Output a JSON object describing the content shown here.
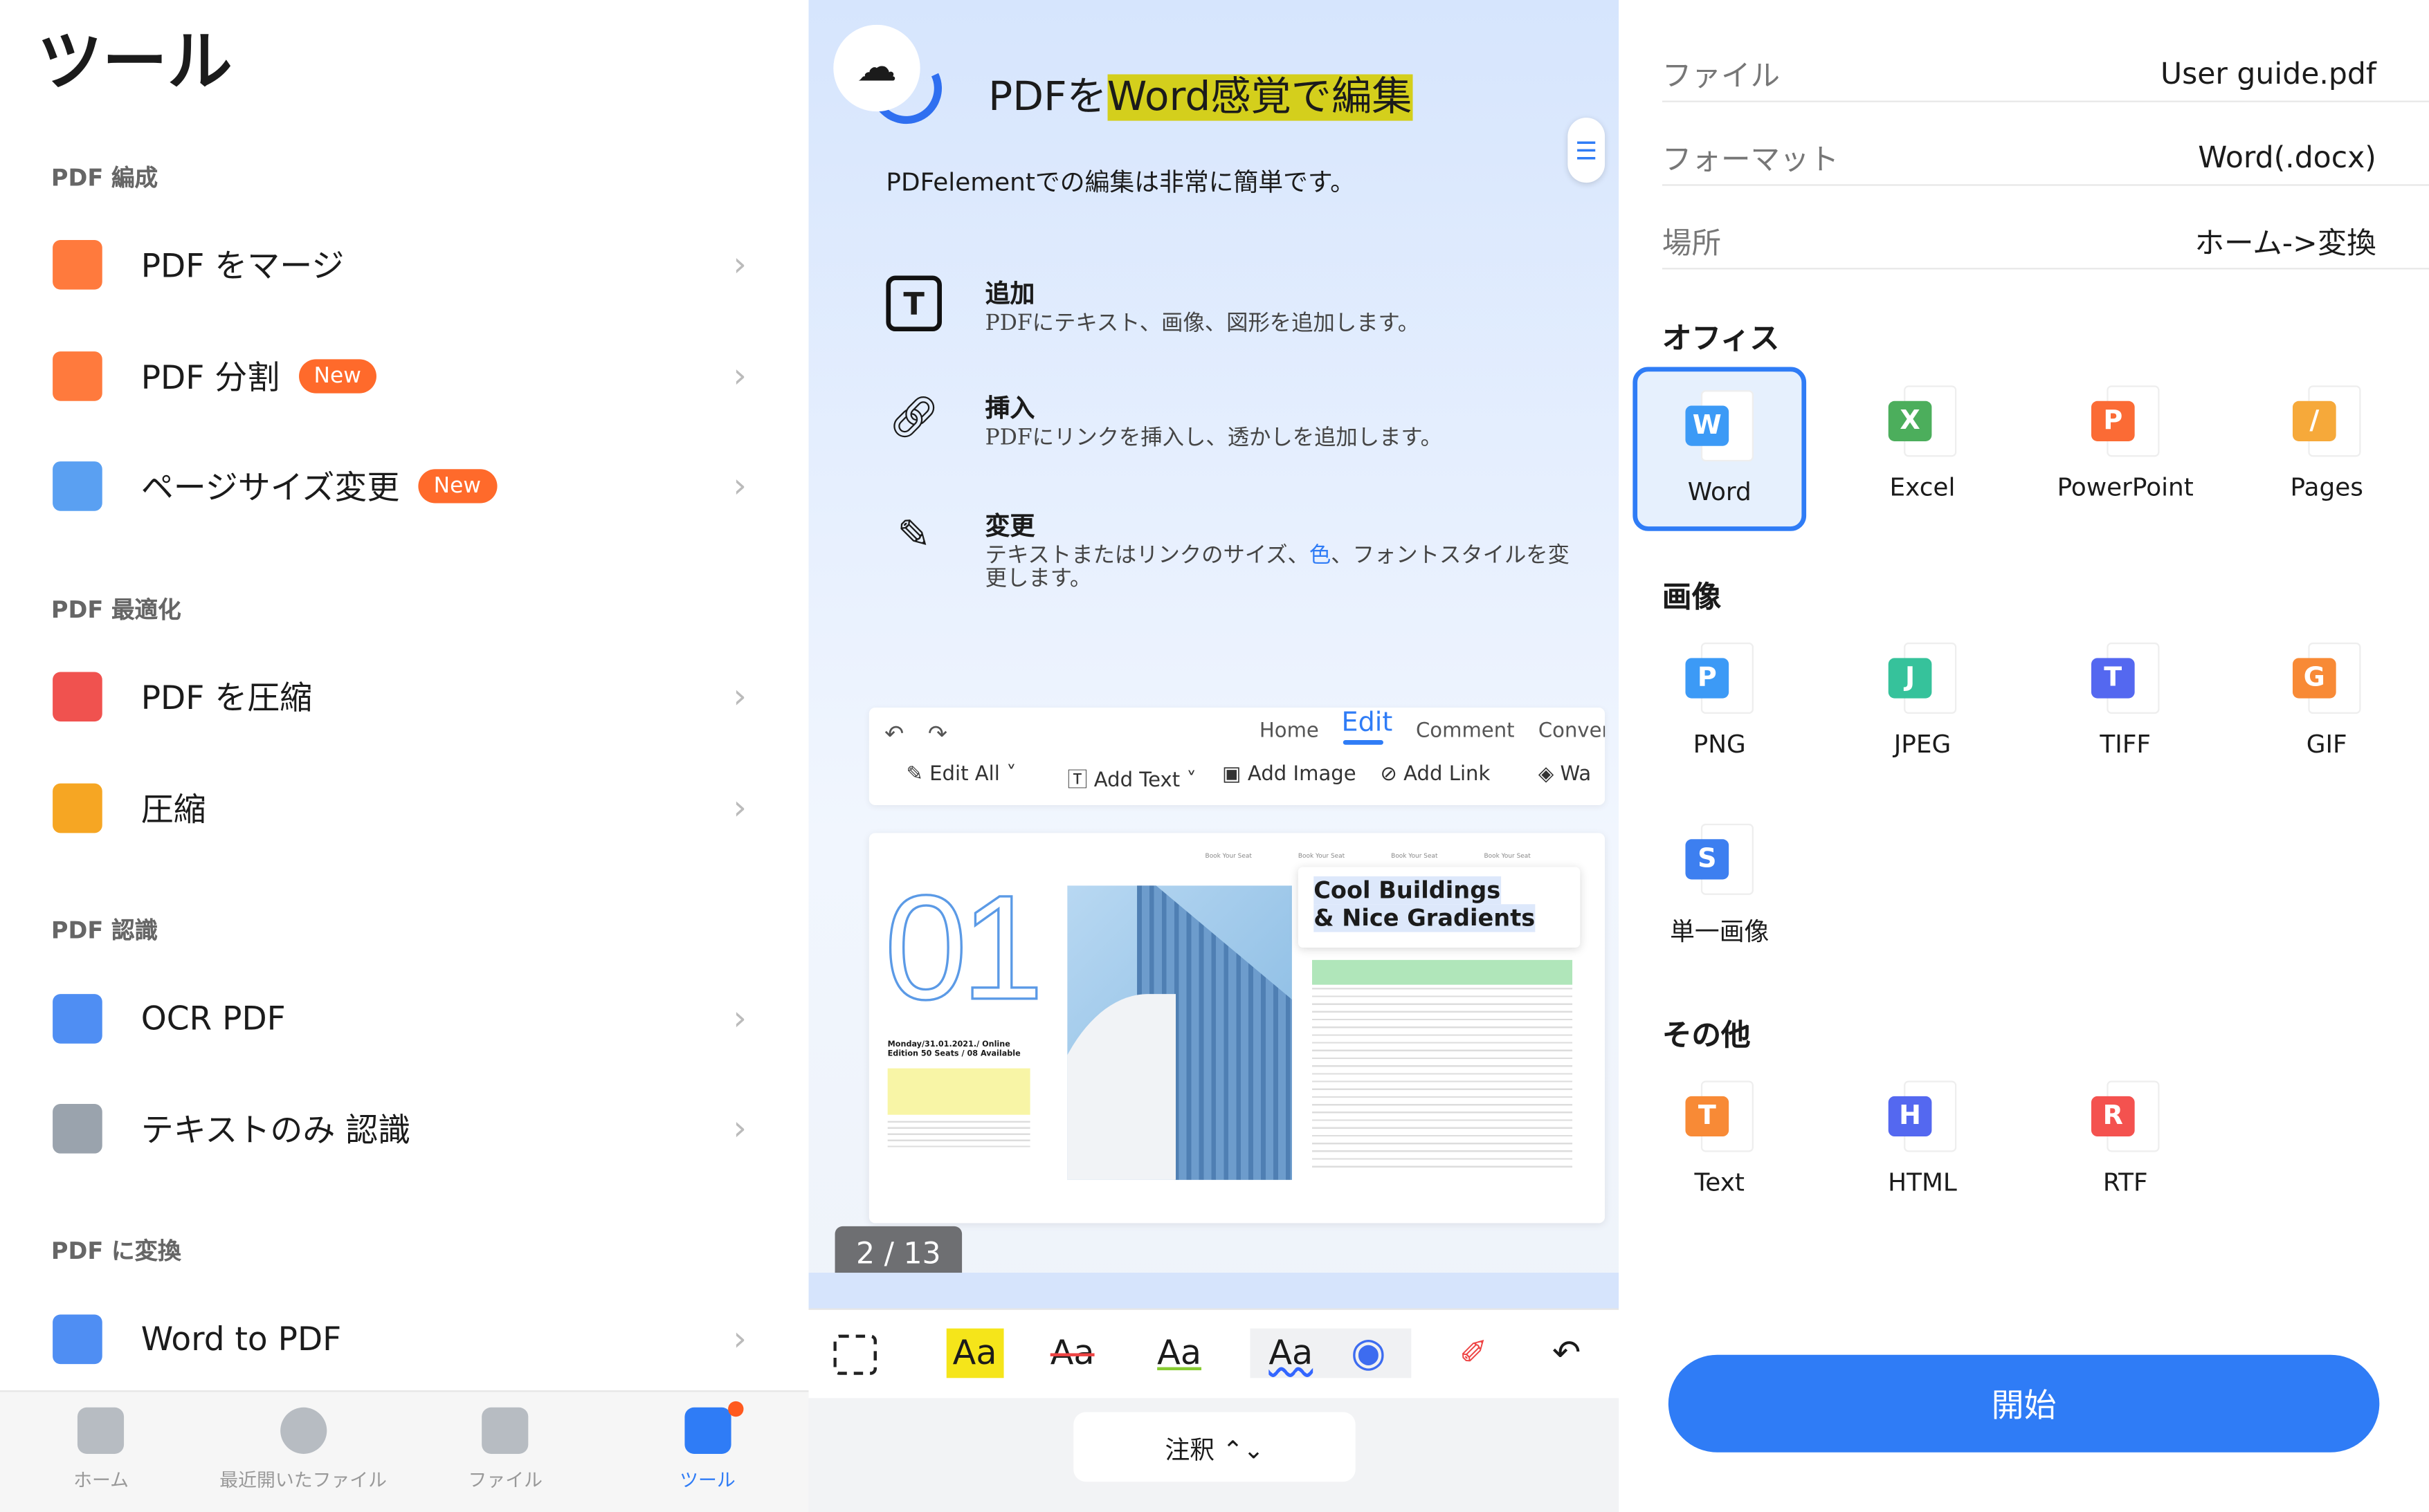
{
  "left": {
    "title": "ツール",
    "sections": [
      {
        "label": "PDF 編成",
        "items": [
          {
            "label": "PDF をマージ",
            "icon": "merge-icon",
            "color": "#ff7a3d"
          },
          {
            "label": "PDF 分割",
            "badge": "New",
            "icon": "split-icon",
            "color": "#ff7a3d"
          },
          {
            "label": "ページサイズ変更",
            "badge": "New",
            "icon": "resize-icon",
            "color": "#5aa0f2"
          }
        ]
      },
      {
        "label": "PDF 最適化",
        "items": [
          {
            "label": "PDF を圧縮",
            "icon": "compress-icon",
            "color": "#f0524f"
          },
          {
            "label": "圧縮",
            "icon": "zip-icon",
            "color": "#f6a623"
          }
        ]
      },
      {
        "label": "PDF 認識",
        "items": [
          {
            "label": "OCR PDF",
            "icon": "ocr-icon",
            "color": "#4f8ef3"
          },
          {
            "label": "テキストのみ 認識",
            "icon": "text-recognize-icon",
            "color": "#9aa3ad"
          }
        ]
      },
      {
        "label": "PDF に変換",
        "items": [
          {
            "label": "Word to PDF",
            "icon": "word-to-pdf-icon",
            "color": "#4f8ef3"
          }
        ]
      }
    ],
    "nav": [
      {
        "label": "ホーム"
      },
      {
        "label": "最近開いたファイル"
      },
      {
        "label": "ファイル"
      },
      {
        "label": "ツール",
        "active": true
      }
    ]
  },
  "middle": {
    "title_pre": "PDFを",
    "title_hl": "Word感覚で編集",
    "subtitle": "PDFelementでの編集は非常に簡単です。",
    "features": [
      {
        "title": "追加",
        "desc": "PDFにテキスト、画像、図形を追加します。"
      },
      {
        "title": "挿入",
        "desc": "PDFにリンクを挿入し、透かしを追加します。"
      },
      {
        "title": "変更",
        "desc_pre": "テキストまたはリンクのサイズ、",
        "desc_hl": "色",
        "desc_post": "、フォントスタイルを変更します。"
      }
    ],
    "toolbar": {
      "tabs": [
        "Home",
        "Edit",
        "Comment",
        "Convert"
      ],
      "buttons": [
        "Edit All ˅",
        "Add Text ˅",
        "Add Image",
        "Add Link",
        "Wa"
      ]
    },
    "doc": {
      "number": "01",
      "date": "Monday/31.01.2021./ Online Edition 50 Seats / 08 Available",
      "book": "Book Your Seat",
      "heading1": "Cool Buildings",
      "heading2": "& Nice Gradients"
    },
    "page_indicator": "2 / 13",
    "annot_button": "注釈 ⌃⌄",
    "annot_tools": [
      "Aa",
      "Aa",
      "Aa",
      "Aa"
    ]
  },
  "right": {
    "info": [
      {
        "key": "ファイル",
        "value": "User guide.pdf"
      },
      {
        "key": "フォーマット",
        "value": "Word(.docx)"
      },
      {
        "key": "場所",
        "value": "ホーム->変換"
      }
    ],
    "groups": [
      {
        "label": "オフィス",
        "items": [
          {
            "label": "Word",
            "letter": "W",
            "color": "#3c9af6",
            "selected": true
          },
          {
            "label": "Excel",
            "letter": "X",
            "color": "#4cae5c"
          },
          {
            "label": "PowerPoint",
            "letter": "P",
            "color": "#fb6b35"
          },
          {
            "label": "Pages",
            "letter": "∕",
            "color": "#f6a93a"
          }
        ]
      },
      {
        "label": "画像",
        "items": [
          {
            "label": "PNG",
            "letter": "P",
            "color": "#3c9af6"
          },
          {
            "label": "JPEG",
            "letter": "J",
            "color": "#36c29b"
          },
          {
            "label": "TIFF",
            "letter": "T",
            "color": "#5468f0"
          },
          {
            "label": "GIF",
            "letter": "G",
            "color": "#f88a36"
          },
          {
            "label": "単一画像",
            "letter": "S",
            "color": "#3d7ff0"
          }
        ]
      },
      {
        "label": "その他",
        "items": [
          {
            "label": "Text",
            "letter": "T",
            "color": "#f88a36"
          },
          {
            "label": "HTML",
            "letter": "H",
            "color": "#5468f0"
          },
          {
            "label": "RTF",
            "letter": "R",
            "color": "#f4524f"
          }
        ]
      }
    ],
    "start": "開始"
  },
  "colors": {
    "accent": "#2f7cf6",
    "badge": "#ff6a2b",
    "highlight": "#d4cf1c"
  }
}
